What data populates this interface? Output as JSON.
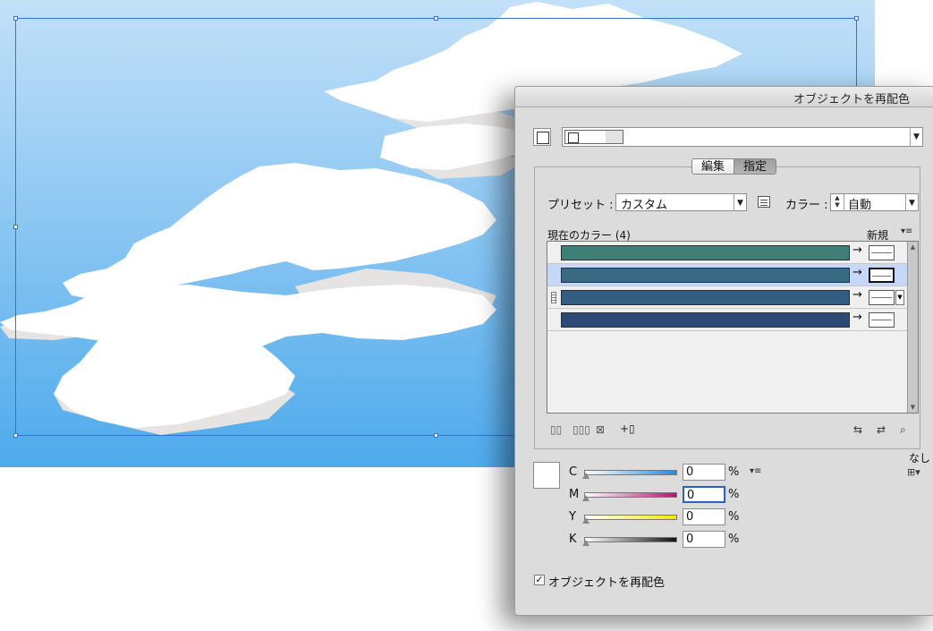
{
  "window": {
    "title": "オブジェクトを再配色"
  },
  "tabs": [
    {
      "label": "編集"
    },
    {
      "label": "指定"
    }
  ],
  "preset": {
    "label": "プリセット :",
    "value": "カスタム"
  },
  "color_setting": {
    "label": "カラー :",
    "value": "自動"
  },
  "current_colors": {
    "header": "現在のカラー (4)",
    "new_header": "新規",
    "rows": [
      {
        "color": "#3e7f78"
      },
      {
        "color": "#386a84"
      },
      {
        "color": "#325c82"
      },
      {
        "color": "#2d4a77"
      }
    ],
    "selected_row_bg": "#c7d7f7"
  },
  "cmyk": {
    "channels": [
      {
        "label": "C",
        "value": "0",
        "gradient": "linear-gradient(90deg,#ffffff,#2a8ad8)"
      },
      {
        "label": "M",
        "value": "0",
        "gradient": "linear-gradient(90deg,#ffffff,#b0156e)"
      },
      {
        "label": "Y",
        "value": "0",
        "gradient": "linear-gradient(90deg,#ffffff,#f0e800)"
      },
      {
        "label": "K",
        "value": "0",
        "gradient": "linear-gradient(90deg,#ffffff,#111111)"
      }
    ],
    "unit": "%"
  },
  "none_label": "なし",
  "recolor_checkbox": {
    "label": "オブジェクトを再配色",
    "checked": true
  },
  "colors": {
    "sky_top": "#c3e0f8",
    "sky_bottom": "#4eaaec",
    "selection": "#3a6fd8",
    "dialog_bg": "#dcdcdc"
  }
}
